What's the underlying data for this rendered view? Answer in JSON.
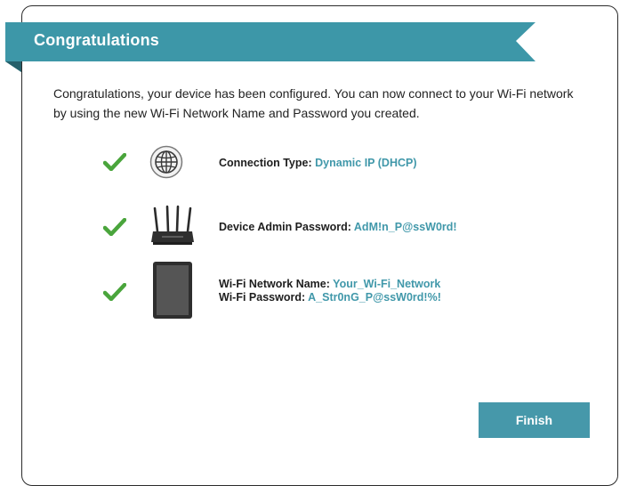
{
  "banner": {
    "title": "Congratulations",
    "color": "#3d97a8",
    "fold_color": "#2a6f7c"
  },
  "intro": {
    "text": "Congratulations, your device has been configured. You can now connect to your Wi-Fi network by using the new Wi-Fi Network Name and Password you created."
  },
  "items": [
    {
      "icon": "globe-icon",
      "label": "Connection Type:",
      "value": "Dynamic IP (DHCP)"
    },
    {
      "icon": "router-icon",
      "label": "Device Admin Password:",
      "value": "AdM!n_P@ssW0rd!"
    },
    {
      "icon": "tablet-icon",
      "label": "Wi-Fi Network Name:",
      "value": "Your_Wi-Fi_Network",
      "label2": "Wi-Fi Password:",
      "value2": "A_Str0nG_P@ssW0rd!%!"
    }
  ],
  "check_color": "#4aa53c",
  "value_color": "#4198aa",
  "finish": {
    "label": "Finish",
    "color": "#4698aa"
  }
}
